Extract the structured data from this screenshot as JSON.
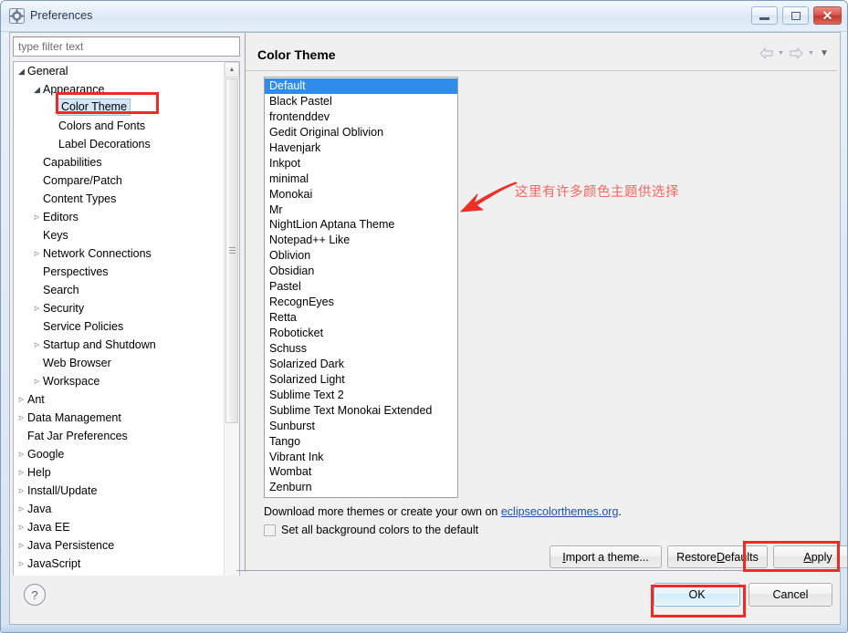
{
  "window": {
    "title": "Preferences",
    "icon": "preferences-gear-icon",
    "controls": {
      "minimize": "minimize-icon",
      "maximize": "maximize-icon",
      "close": "✕"
    }
  },
  "sidebar": {
    "filter": {
      "placeholder": "type filter text",
      "value": ""
    },
    "items": [
      {
        "label": "General",
        "indent": 0,
        "twisty": "open",
        "selected": false
      },
      {
        "label": "Appearance",
        "indent": 1,
        "twisty": "open",
        "selected": false
      },
      {
        "label": "Color Theme",
        "indent": 2,
        "twisty": "none",
        "selected": true
      },
      {
        "label": "Colors and Fonts",
        "indent": 2,
        "twisty": "none",
        "selected": false
      },
      {
        "label": "Label Decorations",
        "indent": 2,
        "twisty": "none",
        "selected": false
      },
      {
        "label": "Capabilities",
        "indent": 1,
        "twisty": "none",
        "selected": false
      },
      {
        "label": "Compare/Patch",
        "indent": 1,
        "twisty": "none",
        "selected": false
      },
      {
        "label": "Content Types",
        "indent": 1,
        "twisty": "none",
        "selected": false
      },
      {
        "label": "Editors",
        "indent": 1,
        "twisty": "closed",
        "selected": false
      },
      {
        "label": "Keys",
        "indent": 1,
        "twisty": "none",
        "selected": false
      },
      {
        "label": "Network Connections",
        "indent": 1,
        "twisty": "closed",
        "selected": false
      },
      {
        "label": "Perspectives",
        "indent": 1,
        "twisty": "none",
        "selected": false
      },
      {
        "label": "Search",
        "indent": 1,
        "twisty": "none",
        "selected": false
      },
      {
        "label": "Security",
        "indent": 1,
        "twisty": "closed",
        "selected": false
      },
      {
        "label": "Service Policies",
        "indent": 1,
        "twisty": "none",
        "selected": false
      },
      {
        "label": "Startup and Shutdown",
        "indent": 1,
        "twisty": "closed",
        "selected": false
      },
      {
        "label": "Web Browser",
        "indent": 1,
        "twisty": "none",
        "selected": false
      },
      {
        "label": "Workspace",
        "indent": 1,
        "twisty": "closed",
        "selected": false
      },
      {
        "label": "Ant",
        "indent": 0,
        "twisty": "closed",
        "selected": false
      },
      {
        "label": "Data Management",
        "indent": 0,
        "twisty": "closed",
        "selected": false
      },
      {
        "label": "Fat Jar Preferences",
        "indent": 0,
        "twisty": "none",
        "selected": false
      },
      {
        "label": "Google",
        "indent": 0,
        "twisty": "closed",
        "selected": false
      },
      {
        "label": "Help",
        "indent": 0,
        "twisty": "closed",
        "selected": false
      },
      {
        "label": "Install/Update",
        "indent": 0,
        "twisty": "closed",
        "selected": false
      },
      {
        "label": "Java",
        "indent": 0,
        "twisty": "closed",
        "selected": false
      },
      {
        "label": "Java EE",
        "indent": 0,
        "twisty": "closed",
        "selected": false
      },
      {
        "label": "Java Persistence",
        "indent": 0,
        "twisty": "closed",
        "selected": false
      },
      {
        "label": "JavaScript",
        "indent": 0,
        "twisty": "closed",
        "selected": false
      }
    ]
  },
  "page": {
    "title": "Color Theme",
    "nav": {
      "back": "back-arrow-icon",
      "back_caret": "▼",
      "forward": "forward-arrow-icon",
      "forward_caret": "▼",
      "menu": "▼"
    },
    "themes": [
      {
        "label": "Default",
        "selected": true
      },
      {
        "label": "Black Pastel",
        "selected": false
      },
      {
        "label": "frontenddev",
        "selected": false
      },
      {
        "label": "Gedit Original Oblivion",
        "selected": false
      },
      {
        "label": "Havenjark",
        "selected": false
      },
      {
        "label": "Inkpot",
        "selected": false
      },
      {
        "label": "minimal",
        "selected": false
      },
      {
        "label": "Monokai",
        "selected": false
      },
      {
        "label": "Mr",
        "selected": false
      },
      {
        "label": "NightLion Aptana Theme",
        "selected": false
      },
      {
        "label": "Notepad++ Like",
        "selected": false
      },
      {
        "label": "Oblivion",
        "selected": false
      },
      {
        "label": "Obsidian",
        "selected": false
      },
      {
        "label": "Pastel",
        "selected": false
      },
      {
        "label": "RecognEyes",
        "selected": false
      },
      {
        "label": "Retta",
        "selected": false
      },
      {
        "label": "Roboticket",
        "selected": false
      },
      {
        "label": "Schuss",
        "selected": false
      },
      {
        "label": "Solarized Dark",
        "selected": false
      },
      {
        "label": "Solarized Light",
        "selected": false
      },
      {
        "label": "Sublime Text 2",
        "selected": false
      },
      {
        "label": "Sublime Text Monokai Extended",
        "selected": false
      },
      {
        "label": "Sunburst",
        "selected": false
      },
      {
        "label": "Tango",
        "selected": false
      },
      {
        "label": "Vibrant Ink",
        "selected": false
      },
      {
        "label": "Wombat",
        "selected": false
      },
      {
        "label": "Zenburn",
        "selected": false
      }
    ],
    "download": {
      "prefix": "Download more themes or create your own on ",
      "link": "eclipsecolorthemes.org",
      "suffix": "."
    },
    "default_bg": {
      "label": "Set all background colors to the default",
      "checked": false
    },
    "buttons": {
      "import": "Import a theme...",
      "restore_pre": "Restore ",
      "restore_key": "D",
      "restore_post": "efaults",
      "apply_pre": "",
      "apply_key": "A",
      "apply_post": "pply",
      "import_key": "I",
      "import_pre": "",
      "import_post": "mport a theme..."
    }
  },
  "footer": {
    "help": "?",
    "ok": "OK",
    "cancel": "Cancel"
  },
  "annotations": {
    "note_text": "这里有许多颜色主题供选择",
    "note_color": "#f2675f",
    "highlight_color": "#ee2b26"
  }
}
